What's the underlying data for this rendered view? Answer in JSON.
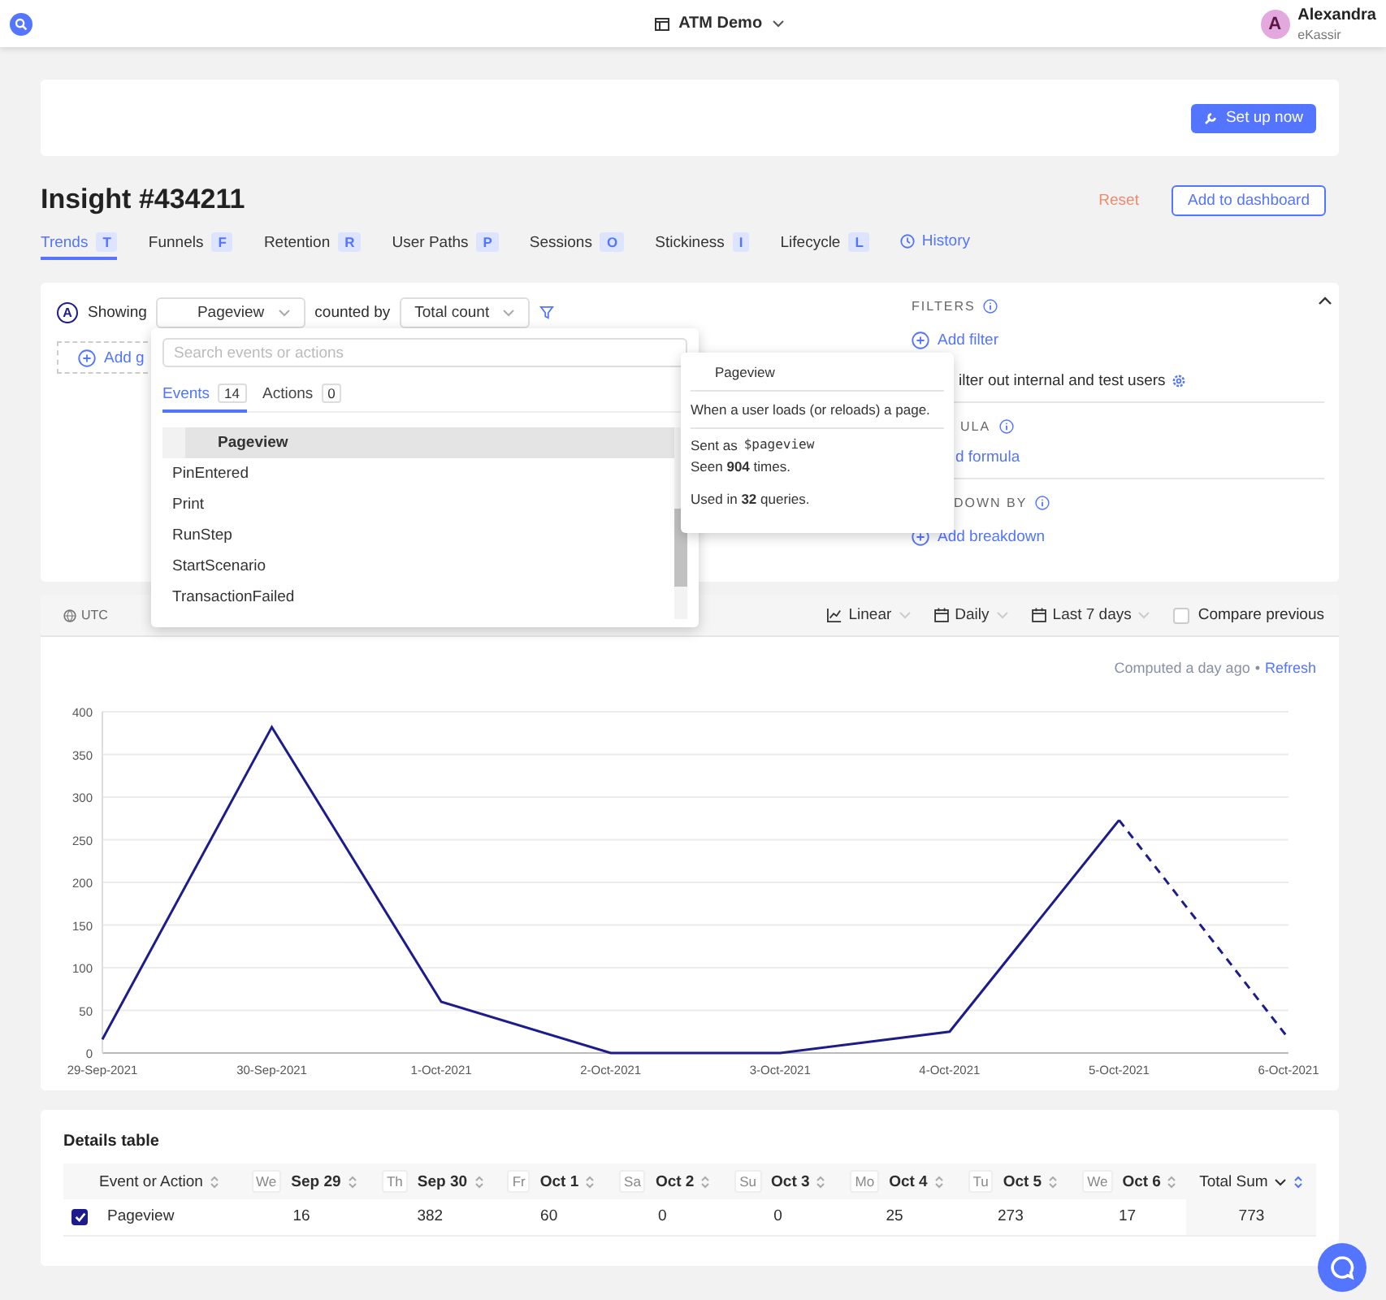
{
  "topbar": {
    "project": "ATM Demo",
    "user_initial": "A",
    "user_name": "Alexandra",
    "org": "eKassir"
  },
  "banner": {
    "button": "Set up now"
  },
  "insight": {
    "title": "Insight #434211",
    "reset": "Reset",
    "add_button": "Add to dashboard"
  },
  "tabs": [
    {
      "label": "Trends",
      "key": "T",
      "selected": true
    },
    {
      "label": "Funnels",
      "key": "F",
      "selected": false
    },
    {
      "label": "Retention",
      "key": "R",
      "selected": false
    },
    {
      "label": "User Paths",
      "key": "P",
      "selected": false
    },
    {
      "label": "Sessions",
      "key": "O",
      "selected": false
    },
    {
      "label": "Stickiness",
      "key": "I",
      "selected": false
    },
    {
      "label": "Lifecycle",
      "key": "L",
      "selected": false
    }
  ],
  "history_link": "History",
  "query": {
    "series_letter": "A",
    "showing": "Showing",
    "event": "Pageview",
    "counted_by": "counted by",
    "math": "Total count",
    "add_graph": "Add g"
  },
  "filters": {
    "title": "FILTERS",
    "add_filter": "Add filter",
    "test_users": "ilter out internal and test users",
    "formula_title": "ULA",
    "add_formula": "d formula",
    "breakdown_title": "DOWN BY",
    "add_breakdown": "Add breakdown"
  },
  "dropdown": {
    "placeholder": "Search events or actions",
    "tabs": [
      {
        "label": "Events",
        "count": "14",
        "selected": true
      },
      {
        "label": "Actions",
        "count": "0",
        "selected": false
      }
    ],
    "items": [
      {
        "label": "Pageview",
        "selected": true
      },
      {
        "label": "PinEntered",
        "selected": false
      },
      {
        "label": "Print",
        "selected": false
      },
      {
        "label": "RunStep",
        "selected": false
      },
      {
        "label": "StartScenario",
        "selected": false
      },
      {
        "label": "TransactionFailed",
        "selected": false
      }
    ]
  },
  "tooltip": {
    "title": "Pageview",
    "description": "When a user loads (or reloads) a page.",
    "sent_as": "Sent as",
    "event_name": "$pageview",
    "seen": "Seen **904** times.",
    "used": "Used in **32** queries."
  },
  "chart_toolbar": {
    "timezone": "UTC",
    "scale": "Linear",
    "interval": "Daily",
    "range": "Last 7 days",
    "compare": "Compare previous",
    "compare_checked": false
  },
  "computed": {
    "text": "Computed a day ago",
    "separator": "•",
    "refresh": "Refresh"
  },
  "chart": {
    "chart_data": {
      "type": "line",
      "categories": [
        "29-Sep-2021",
        "30-Sep-2021",
        "1-Oct-2021",
        "2-Oct-2021",
        "3-Oct-2021",
        "4-Oct-2021",
        "5-Oct-2021",
        "6-Oct-2021"
      ],
      "grid": true,
      "series": [
        {
          "color": "#1c1c8c",
          "values": [
            16,
            382,
            60,
            0,
            0,
            25,
            273,
            17
          ]
        }
      ],
      "ylim": [
        0,
        400
      ],
      "yticks": [
        0,
        50,
        100,
        150,
        200,
        250,
        300,
        350,
        400
      ]
    }
  },
  "details": {
    "title": "Details table",
    "first_column": "Event or Action",
    "columns": [
      {
        "weekday": "We",
        "date": "Sep 29"
      },
      {
        "weekday": "Th",
        "date": "Sep 30"
      },
      {
        "weekday": "Fr",
        "date": "Oct 1"
      },
      {
        "weekday": "Sa",
        "date": "Oct 2"
      },
      {
        "weekday": "Su",
        "date": "Oct 3"
      },
      {
        "weekday": "Mo",
        "date": "Oct 4"
      },
      {
        "weekday": "Tu",
        "date": "Oct 5"
      },
      {
        "weekday": "We",
        "date": "Oct 6"
      }
    ],
    "total_column": "Total Sum",
    "rows": [
      {
        "checked": true,
        "name": "Pageview",
        "values": [
          "16",
          "382",
          "60",
          "0",
          "0",
          "25",
          "273",
          "17"
        ],
        "total": "773"
      }
    ]
  }
}
